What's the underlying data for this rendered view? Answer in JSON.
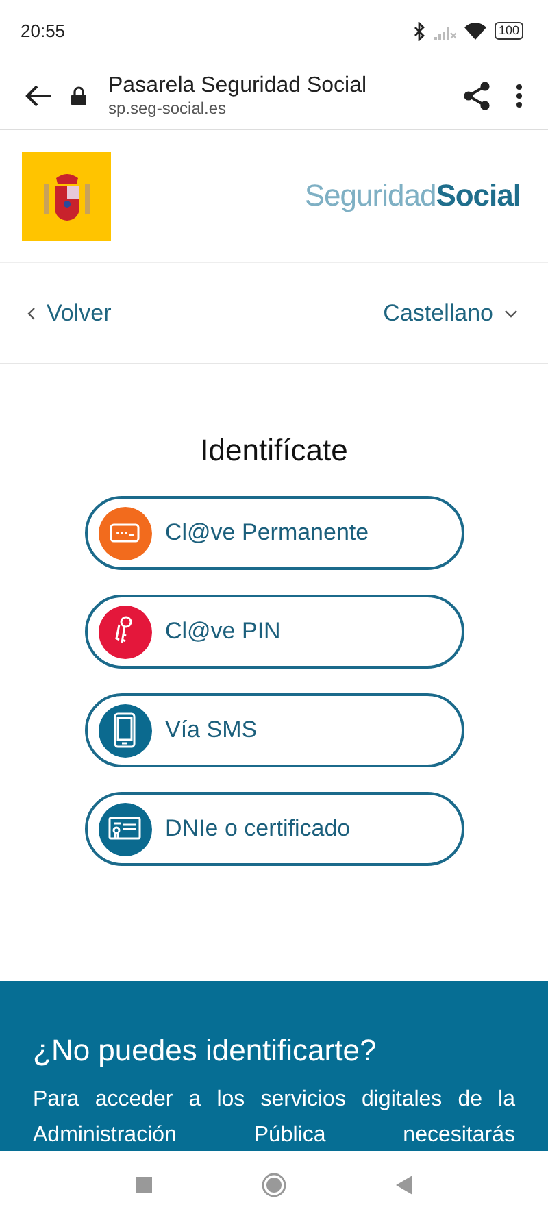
{
  "status_bar": {
    "time": "20:55",
    "battery": "100"
  },
  "browser": {
    "title": "Pasarela Seguridad Social",
    "url": "sp.seg-social.es"
  },
  "header": {
    "logo_regular": "Seguridad",
    "logo_bold": "Social"
  },
  "nav": {
    "back": "Volver",
    "language": "Castellano"
  },
  "heading": "Identifícate",
  "options": [
    {
      "label": "Cl@ve Permanente",
      "kind": "password",
      "color": "#f26b1d"
    },
    {
      "label": "Cl@ve PIN",
      "kind": "pin",
      "color": "#e4173b"
    },
    {
      "label": "Vía SMS",
      "kind": "sms",
      "color": "#0b6a8f"
    },
    {
      "label": "DNIe o certificado",
      "kind": "certificate",
      "color": "#0b6a8f"
    }
  ],
  "help": {
    "title": "¿No puedes identificarte?",
    "text": "Para acceder a los servicios digitales de la Administración Pública necesitarás"
  }
}
